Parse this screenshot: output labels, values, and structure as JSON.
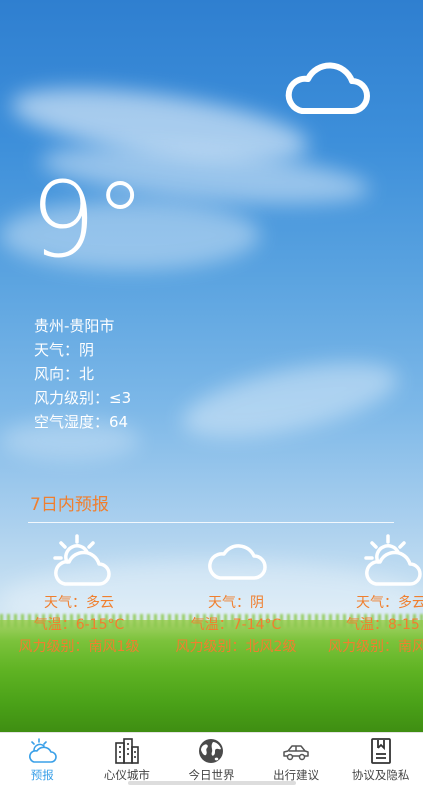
{
  "current": {
    "temperature": "9°",
    "location": "贵州-贵阳市",
    "weather": "天气：阴",
    "wind_direction": "风向：北",
    "wind_level": "风力级别：≤3",
    "humidity": "空气湿度：64",
    "icon": "cloudy-icon"
  },
  "forecast": {
    "title": "7日内预报",
    "days": [
      {
        "icon": "partly-cloudy-icon",
        "weather": "天气：多云",
        "temp": "气温：6-15°C",
        "wind": "风力级别：南风1级"
      },
      {
        "icon": "cloudy-icon",
        "weather": "天气：阴",
        "temp": "气温：7-14°C",
        "wind": "风力级别：北风2级"
      },
      {
        "icon": "partly-cloudy-icon",
        "weather": "天气：多云",
        "temp": "气温：8-15",
        "wind": "风力级别：南风"
      }
    ]
  },
  "tabbar": {
    "items": [
      {
        "label": "预报",
        "icon": "forecast-icon",
        "active": true
      },
      {
        "label": "心仪城市",
        "icon": "city-icon",
        "active": false
      },
      {
        "label": "今日世界",
        "icon": "globe-icon",
        "active": false
      },
      {
        "label": "出行建议",
        "icon": "car-icon",
        "active": false
      },
      {
        "label": "协议及隐私",
        "icon": "document-icon",
        "active": false
      }
    ]
  },
  "colors": {
    "accent_orange": "#f07f2e",
    "tab_active": "#3aa0e8"
  }
}
